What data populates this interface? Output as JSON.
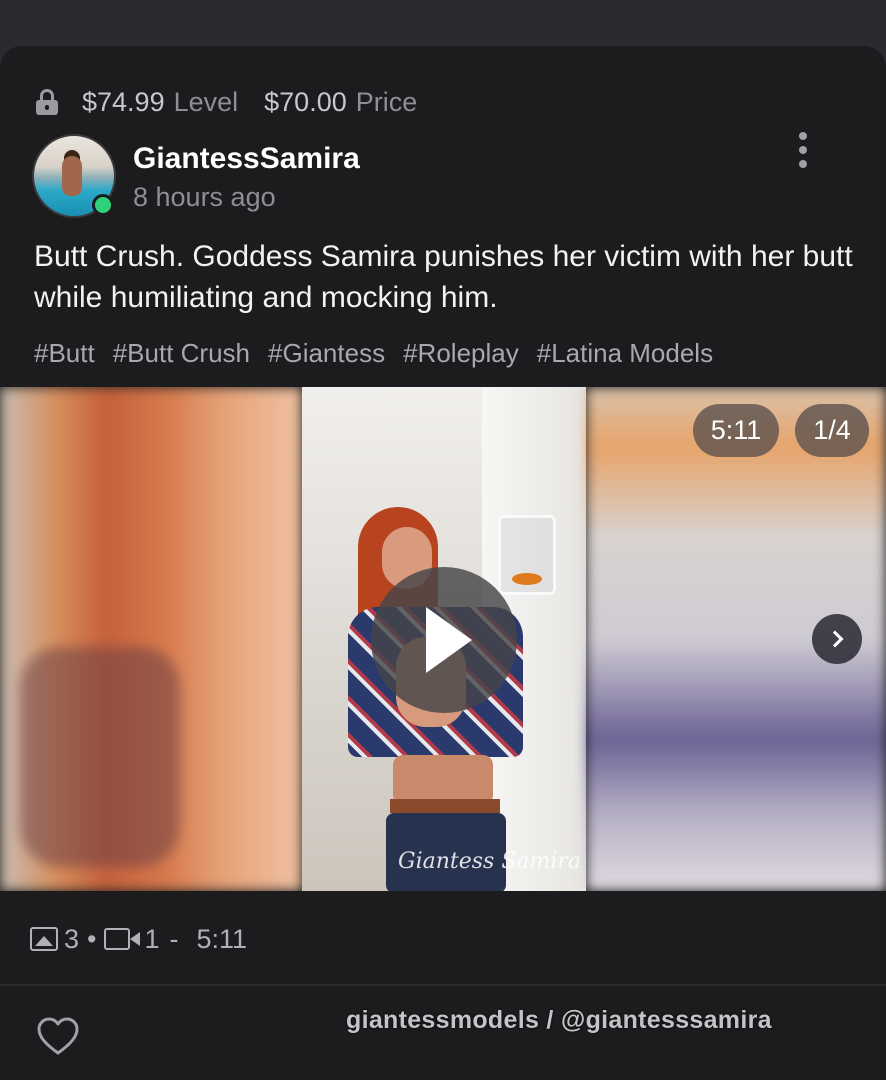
{
  "pricing": {
    "level_value": "$74.99",
    "level_label": "Level",
    "price_value": "$70.00",
    "price_label": "Price"
  },
  "post": {
    "author": "GiantessSamira",
    "time": "8 hours ago",
    "description": "Butt Crush. Goddess Samira punishes her victim with her butt while humiliating and mocking him.",
    "tags": [
      "#Butt",
      "#Butt Crush",
      "#Giantess",
      "#Roleplay",
      "#Latina Models"
    ]
  },
  "media": {
    "duration": "5:11",
    "position": "1/4",
    "video_watermark": "Giantess Samira"
  },
  "stats": {
    "image_count": "3",
    "separator": "•",
    "video_count": "1",
    "dash": "-",
    "total_duration": "5:11"
  },
  "footer": {
    "watermark": "giantessmodels / @giantesssamira"
  },
  "colors": {
    "card_bg": "#1c1c1e",
    "online": "#2fd07a",
    "text_muted": "#8e8e93"
  },
  "icons": [
    "lock-icon",
    "more-vertical-icon",
    "play-icon",
    "chevron-right-icon",
    "image-icon",
    "video-icon",
    "heart-icon"
  ]
}
